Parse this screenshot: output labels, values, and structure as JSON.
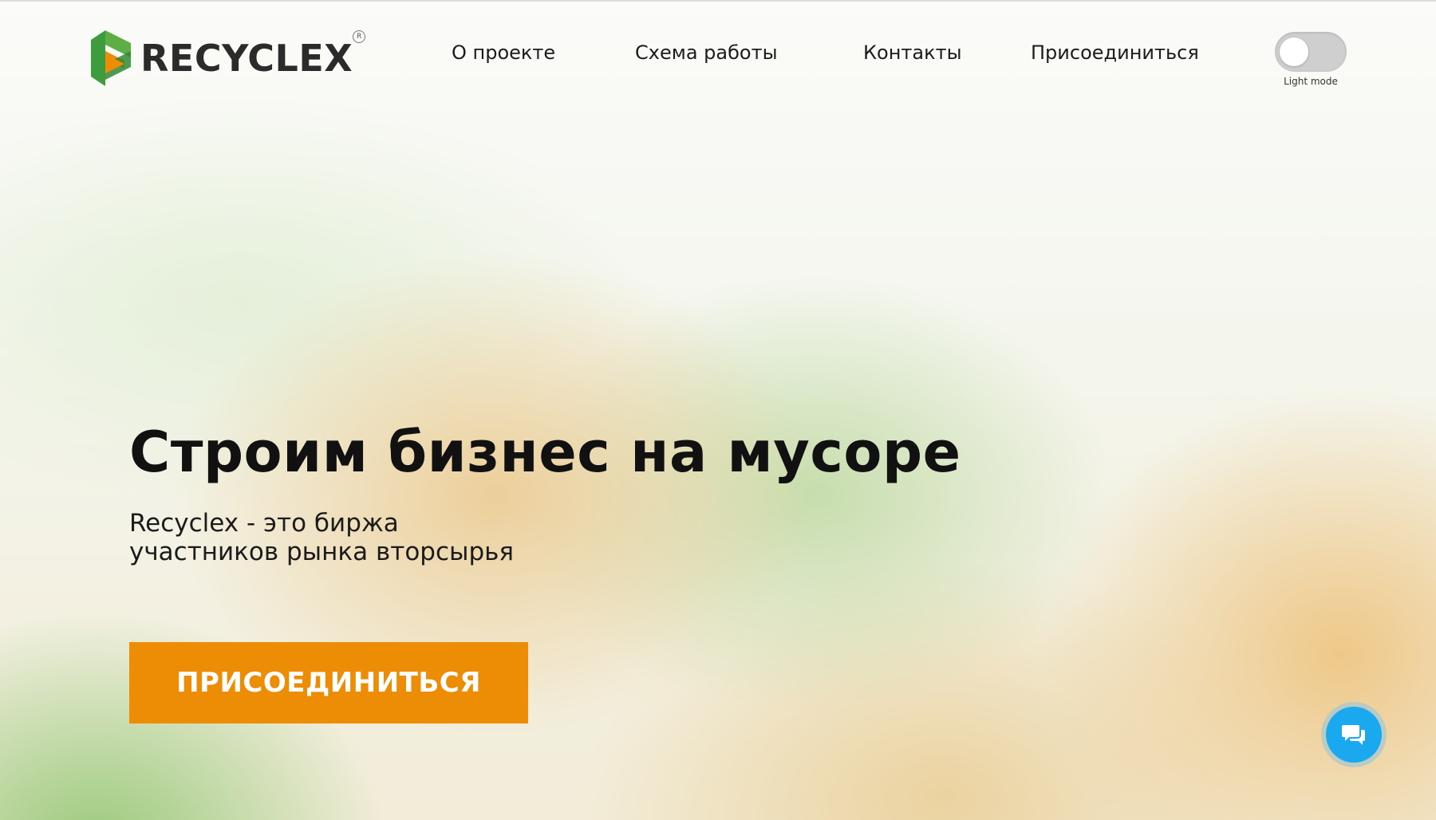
{
  "header": {
    "logo_text": "RECYCLEX",
    "logo_registered": "R",
    "nav": [
      {
        "label": "О проекте"
      },
      {
        "label": "Схема работы"
      },
      {
        "label": "Контакты"
      },
      {
        "label": "Присоединиться"
      }
    ],
    "theme_toggle": {
      "label": "Light mode",
      "state": "off"
    }
  },
  "hero": {
    "title": "Строим бизнес на мусоре",
    "subtitle_line1": "Recyclex - это биржа",
    "subtitle_line2": "участников рынка вторсырья",
    "cta_label": "ПРИСОЕДИНИТЬСЯ"
  },
  "chat": {
    "icon": "chat-bubbles-icon"
  },
  "colors": {
    "accent_orange": "#ec8d05",
    "logo_green": "#3e9c3f",
    "logo_orange": "#ec8d05",
    "chat_blue": "#1aa8ee"
  }
}
